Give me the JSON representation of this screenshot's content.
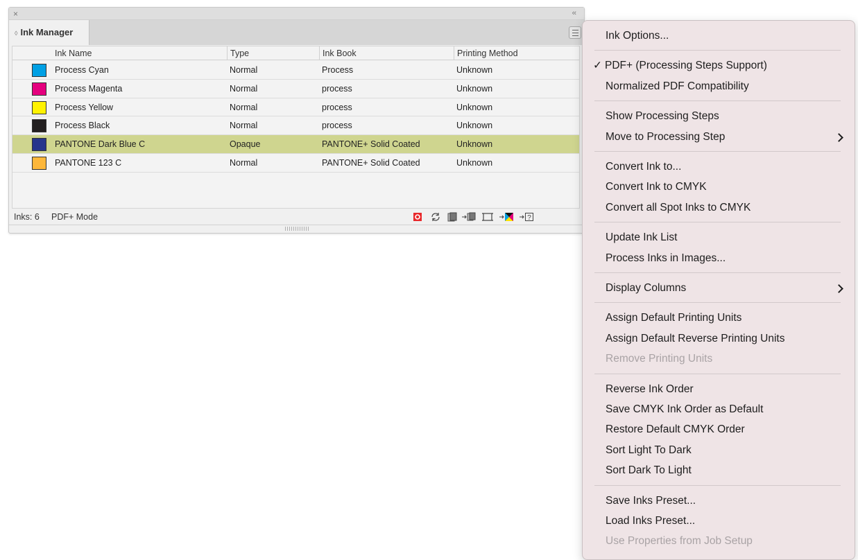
{
  "panel": {
    "close_glyph": "×",
    "collapse_glyph": "‹‹",
    "tab_label": "Ink Manager",
    "columns": [
      "Ink Name",
      "Type",
      "Ink Book",
      "Printing Method"
    ],
    "inks": [
      {
        "name": "Process Cyan",
        "type": "Normal",
        "book": "Process",
        "method": "Unknown",
        "color": "#00a0e4",
        "selected": false
      },
      {
        "name": "Process Magenta",
        "type": "Normal",
        "book": "process",
        "method": "Unknown",
        "color": "#e5007e",
        "selected": false
      },
      {
        "name": "Process Yellow",
        "type": "Normal",
        "book": "process",
        "method": "Unknown",
        "color": "#fff200",
        "selected": false
      },
      {
        "name": "Process Black",
        "type": "Normal",
        "book": "process",
        "method": "Unknown",
        "color": "#231f20",
        "selected": false
      },
      {
        "name": "PANTONE Dark Blue C",
        "type": "Opaque",
        "book": "PANTONE+ Solid Coated",
        "method": "Unknown",
        "color": "#26358c",
        "selected": true
      },
      {
        "name": "PANTONE 123 C",
        "type": "Normal",
        "book": "PANTONE+ Solid Coated",
        "method": "Unknown",
        "color": "#fdb73a",
        "selected": false
      }
    ],
    "status": {
      "inks_label": "Inks: 6",
      "mode_label": "PDF+ Mode"
    },
    "selection_color": "#cfd58f"
  },
  "menu": {
    "groups": [
      [
        {
          "label": "Ink Options..."
        }
      ],
      [
        {
          "label": "PDF+ (Processing Steps Support)",
          "checked": true,
          "check_glyph": "✓"
        },
        {
          "label": "Normalized PDF Compatibility"
        }
      ],
      [
        {
          "label": "Show Processing Steps"
        },
        {
          "label": "Move to Processing Step",
          "submenu": true
        }
      ],
      [
        {
          "label": "Convert Ink to..."
        },
        {
          "label": "Convert Ink to CMYK"
        },
        {
          "label": "Convert all Spot Inks to CMYK"
        }
      ],
      [
        {
          "label": "Update Ink List"
        },
        {
          "label": "Process Inks in Images..."
        }
      ],
      [
        {
          "label": "Display Columns",
          "submenu": true
        }
      ],
      [
        {
          "label": "Assign Default Printing Units"
        },
        {
          "label": "Assign Default Reverse Printing Units"
        },
        {
          "label": "Remove Printing Units",
          "disabled": true
        }
      ],
      [
        {
          "label": "Reverse Ink Order"
        },
        {
          "label": "Save CMYK Ink Order as Default"
        },
        {
          "label": "Restore Default CMYK Order"
        },
        {
          "label": "Sort Light To Dark"
        },
        {
          "label": "Sort Dark To Light"
        }
      ],
      [
        {
          "label": "Save Inks Preset..."
        },
        {
          "label": "Load Inks Preset..."
        },
        {
          "label": "Use Properties from Job Setup",
          "disabled": true
        }
      ]
    ]
  }
}
